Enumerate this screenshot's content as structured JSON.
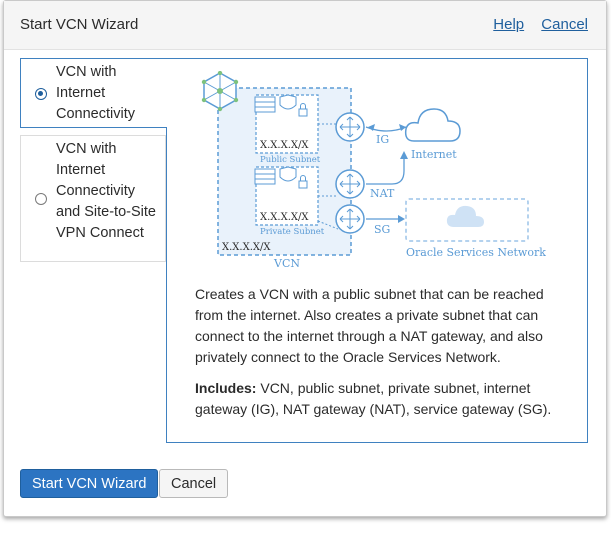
{
  "header": {
    "title": "Start VCN Wizard",
    "help": "Help",
    "cancel": "Cancel"
  },
  "options": [
    {
      "label": "VCN with Internet Connectivity",
      "selected": true
    },
    {
      "label": "VCN with Internet Connectivity and Site-to-Site VPN Connect",
      "selected": false
    }
  ],
  "diagram": {
    "public_subnet": "Public Subnet",
    "private_subnet": "Private Subnet",
    "cidr": "X.X.X.X/X",
    "vcn": "VCN",
    "ig": "IG",
    "nat": "NAT",
    "sg": "SG",
    "internet": "Internet",
    "oracle_services": "Oracle Services Network"
  },
  "description": {
    "text": "Creates a VCN with a public subnet that can be reached from the internet. Also creates a private subnet that can connect to the internet through a NAT gateway, and also privately connect to the Oracle Services Network.",
    "includes_label": "Includes:",
    "includes_text": " VCN, public subnet, private subnet, internet gateway (IG), NAT gateway (NAT), service gateway (SG)."
  },
  "footer": {
    "start_button": "Start VCN Wizard",
    "cancel_button": "Cancel"
  },
  "colors": {
    "accent": "#2c74c2",
    "link": "#1f5f9d",
    "diagram": "#5b9bd5"
  }
}
